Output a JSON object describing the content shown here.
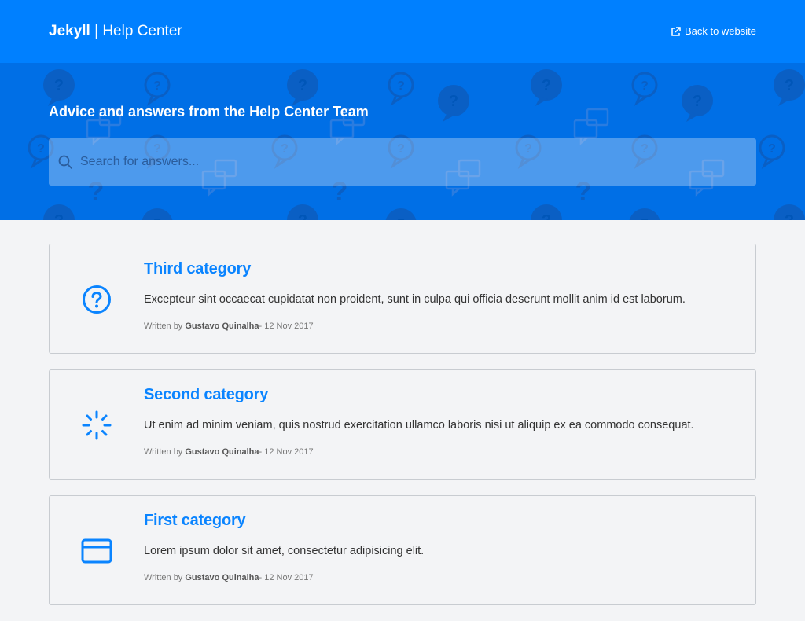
{
  "header": {
    "brand_bold": "Jekyll",
    "brand_sep": " | ",
    "brand_rest": "Help Center",
    "back_label": "Back to website"
  },
  "hero": {
    "tagline": "Advice and answers from the Help Center Team",
    "search_placeholder": "Search for answers..."
  },
  "categories": [
    {
      "title": "Third category",
      "icon": "question-circle-icon",
      "description": "Excepteur sint occaecat cupidatat non proident, sunt in culpa qui officia deserunt mollit anim id est laborum.",
      "written_by_label": "Written by",
      "author": "Gustavo Quinalha",
      "date": "12 Nov 2017"
    },
    {
      "title": "Second category",
      "icon": "loader-icon",
      "description": "Ut enim ad minim veniam, quis nostrud exercitation ullamco laboris nisi ut aliquip ex ea commodo consequat.",
      "written_by_label": "Written by",
      "author": "Gustavo Quinalha",
      "date": "12 Nov 2017"
    },
    {
      "title": "First category",
      "icon": "credit-card-icon",
      "description": "Lorem ipsum dolor sit amet, consectetur adipisicing elit.",
      "written_by_label": "Written by",
      "author": "Gustavo Quinalha",
      "date": "12 Nov 2017"
    }
  ],
  "colors": {
    "header_bg": "#0080ff",
    "hero_bg": "#006fe6",
    "accent": "#0a84ff",
    "page_bg": "#f3f4f6"
  }
}
